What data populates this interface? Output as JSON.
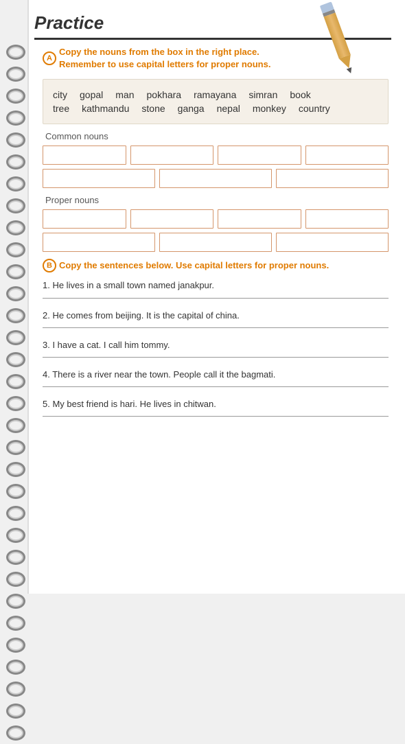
{
  "title": "Practice",
  "pencil": "pencil",
  "sectionA": {
    "label": "A",
    "instruction_line1": "Copy the nouns from the box in the right place.",
    "instruction_line2": "Remember to use capital letters for proper nouns.",
    "words_row1": [
      "city",
      "gopal",
      "man",
      "pokhara",
      "ramayana",
      "simran",
      "book"
    ],
    "words_row2": [
      "tree",
      "kathmandu",
      "stone",
      "ganga",
      "nepal",
      "monkey",
      "country"
    ],
    "common_nouns_label": "Common nouns",
    "proper_nouns_label": "Proper nouns"
  },
  "sectionB": {
    "label": "B",
    "instruction": "Copy the sentences below. Use capital letters for proper nouns.",
    "sentences": [
      "1. He lives in a small town named janakpur.",
      "2. He comes from beijing. It is the capital of china.",
      "3. I have a cat. I call him tommy.",
      "4. There is a river near the town. People call it the bagmati.",
      "5. My best friend is hari. He lives in chitwan."
    ]
  }
}
